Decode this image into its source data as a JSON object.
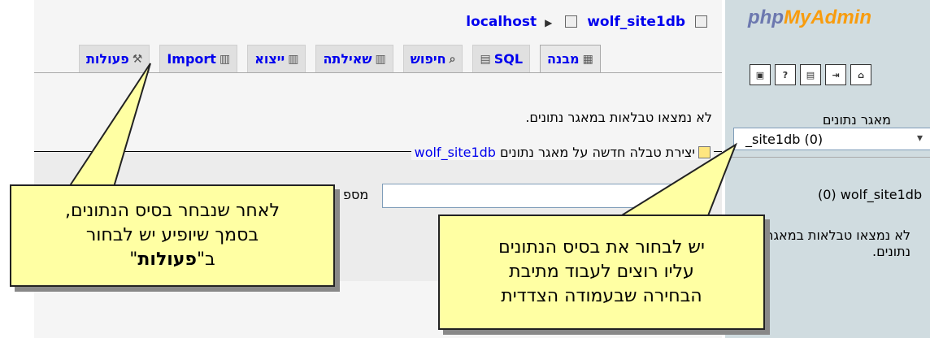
{
  "breadcrumb": {
    "server": "localhost",
    "database": "wolf_site1db"
  },
  "tabs": [
    {
      "label": "מבנה",
      "icon": "structure-icon",
      "active": true
    },
    {
      "label": "SQL",
      "icon": "sql-icon"
    },
    {
      "label": "חיפוש",
      "icon": "search-icon"
    },
    {
      "label": "שאילתה",
      "icon": "query-icon"
    },
    {
      "label": "ייצוא",
      "icon": "export-icon"
    },
    {
      "label": "Import",
      "icon": "import-icon"
    },
    {
      "label": "פעולות",
      "icon": "operations-icon"
    }
  ],
  "main": {
    "no_tables": "לא נמצאו טבלאות במאגר נתונים.",
    "create_table_legend": "יצירת טבלה חדשה על מאגר נתונים",
    "create_table_db": "wolf_site1db",
    "fields_label": "מספ"
  },
  "nav": {
    "logo_a": "php",
    "logo_b": "MyAdmin",
    "icons": [
      "home-icon",
      "exit-icon",
      "sql-icon",
      "help-icon",
      "query-window-icon"
    ],
    "db_label": "מאגר נתונים",
    "db_selected": "_site1db (0)",
    "db_name": "(0) wolf_site1db",
    "no_tables_l1": "לא נמצאו טבלאות במאגר",
    "no_tables_l2": "נתונים."
  },
  "callouts": {
    "left_l1": "לאחר שנבחר בסיס הנתונים,",
    "left_l2": "בסמך שיופיע יש לבחור",
    "left_l3_pre": "ב\"",
    "left_l3_bold": "פעולות",
    "left_l3_post": "\"",
    "right_l1": "יש לבחור את בסיס הנתונים",
    "right_l2": "עליו רוצים לעבוד מתיבת",
    "right_l3": "הבחירה שבעמודה הצדדית"
  },
  "colors": {
    "link": "#0000ee",
    "callout_bg": "#ffffa3",
    "nav_bg": "#d0dce0",
    "logo_orange": "#f89c0e",
    "logo_blue": "#6c78af"
  }
}
